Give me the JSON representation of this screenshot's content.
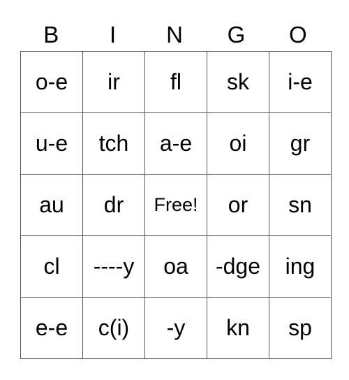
{
  "header": [
    "B",
    "I",
    "N",
    "G",
    "O"
  ],
  "rows": [
    [
      "o-e",
      "ir",
      "fl",
      "sk",
      "i-e"
    ],
    [
      "u-e",
      "tch",
      "a-e",
      "oi",
      "gr"
    ],
    [
      "au",
      "dr",
      "Free!",
      "or",
      "sn"
    ],
    [
      "cl",
      "----y",
      "oa",
      "-dge",
      "ing"
    ],
    [
      "e-e",
      "c(i)",
      "-y",
      "kn",
      "sp"
    ]
  ]
}
